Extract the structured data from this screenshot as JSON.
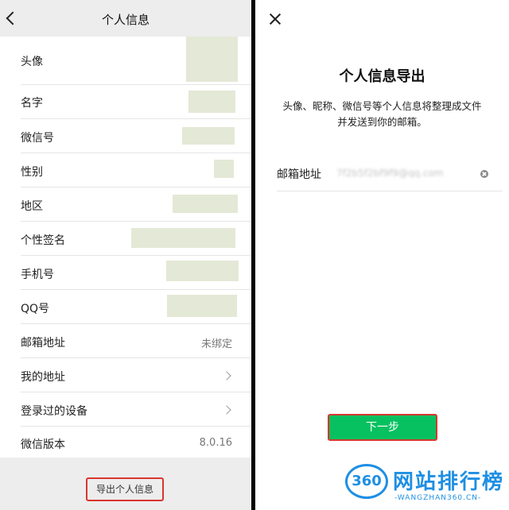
{
  "left": {
    "title": "个人信息",
    "rows": [
      {
        "label": "头像"
      },
      {
        "label": "名字"
      },
      {
        "label": "微信号"
      },
      {
        "label": "性别"
      },
      {
        "label": "地区"
      },
      {
        "label": "个性签名"
      },
      {
        "label": "手机号"
      },
      {
        "label": "QQ号"
      },
      {
        "label": "邮箱地址",
        "value": "未绑定"
      },
      {
        "label": "我的地址"
      },
      {
        "label": "登录过的设备"
      },
      {
        "label": "微信版本",
        "value": "8.0.16"
      }
    ],
    "export_button": "导出个人信息"
  },
  "right": {
    "title": "个人信息导出",
    "description_line1": "头像、昵称、微信号等个人信息将整理成文件",
    "description_line2": "并发送到你的邮箱。",
    "email_label": "邮箱地址",
    "email_value": "7f2b5f2bf9f9@qq.com",
    "next_button": "下一步"
  },
  "watermark": {
    "logo": "360",
    "text": "网站排行榜",
    "url": "-WANGZHAN360.CN-"
  }
}
